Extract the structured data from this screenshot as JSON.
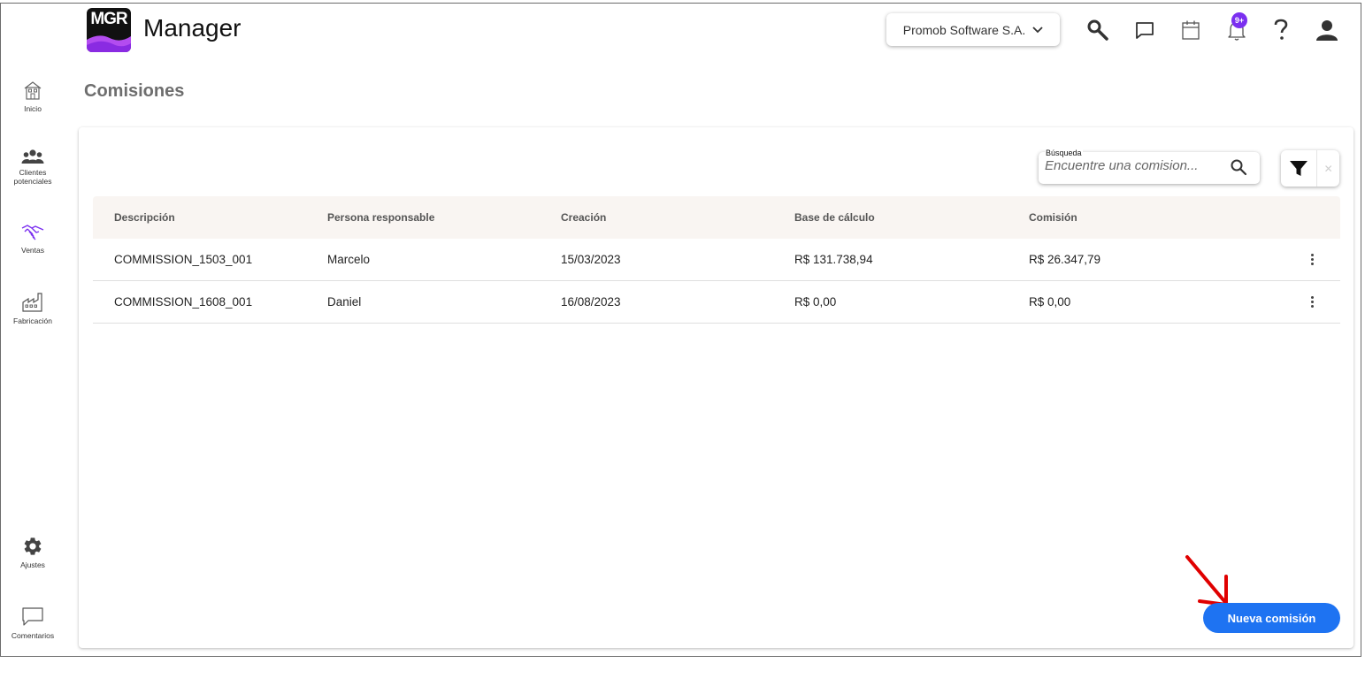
{
  "app": {
    "logo_text": "MGR",
    "name": "Manager"
  },
  "header": {
    "company": "Promob Software S.A.",
    "notifications_badge": "9+"
  },
  "sidebar": {
    "items": [
      {
        "label": "Inicio",
        "icon": "home-icon"
      },
      {
        "label_lines": [
          "Clientes",
          "potenciales"
        ],
        "icon": "people-icon"
      },
      {
        "label": "Ventas",
        "icon": "handshake-icon"
      },
      {
        "label": "Fabricación",
        "icon": "factory-icon"
      },
      {
        "label": "Ajustes",
        "icon": "gear-icon"
      },
      {
        "label": "Comentarios",
        "icon": "comment-icon"
      }
    ]
  },
  "page": {
    "title": "Comisiones"
  },
  "search": {
    "label": "Búsqueda",
    "placeholder": "Encuentre una comision..."
  },
  "table": {
    "columns": [
      "Descripción",
      "Persona responsable",
      "Creación",
      "Base de cálculo",
      "Comisión"
    ],
    "rows": [
      [
        "COMMISSION_1503_001",
        "Marcelo",
        "15/03/2023",
        "R$ 131.738,94",
        "R$ 26.347,79"
      ],
      [
        "COMMISSION_1608_001",
        "Daniel",
        "16/08/2023",
        "R$ 0,00",
        "R$ 0,00"
      ]
    ]
  },
  "actions": {
    "new_label": "Nueva comisión"
  },
  "colors": {
    "primary": "#1e73f2",
    "sidebar_active": "#7b2ff0",
    "badge": "#7b2ff0",
    "annotation_arrow": "#e00000"
  }
}
